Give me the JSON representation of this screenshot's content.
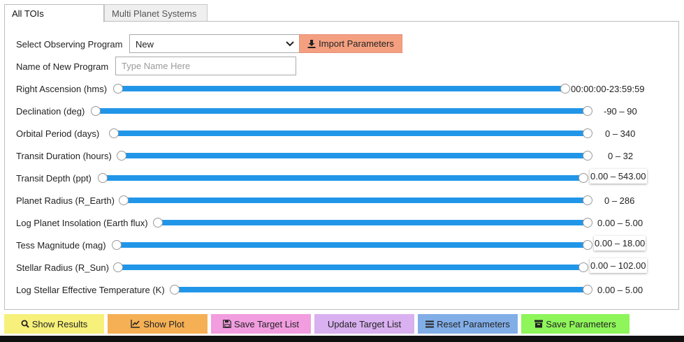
{
  "tabs": [
    {
      "label": "All TOIs",
      "active": true
    },
    {
      "label": "Multi Planet Systems",
      "active": false
    }
  ],
  "program": {
    "select_label": "Select Observing Program",
    "selected": "New",
    "import_label": "Import Parameters",
    "name_label": "Name of New Program",
    "name_value": "",
    "name_placeholder": "Type Name Here"
  },
  "sliders": [
    {
      "label": "Right Ascension (hms)",
      "value": "00:00:00-23:59:59"
    },
    {
      "label": "Declination (deg)",
      "value": "-90 – 90"
    },
    {
      "label": "Orbital Period (days)",
      "value": "0 – 340"
    },
    {
      "label": "Transit Duration (hours)",
      "value": "0 – 32"
    },
    {
      "label": "Transit Depth (ppt)",
      "value": "0.00 – 543.00"
    },
    {
      "label": "Planet Radius (R_Earth)",
      "value": "0 – 286"
    },
    {
      "label": "Log Planet Insolation (Earth flux)",
      "value": "0.00 – 5.00"
    },
    {
      "label": "Tess Magnitude (mag)",
      "value": "0.00 – 18.00"
    },
    {
      "label": "Stellar Radius (R_Sun)",
      "value": "0.00 – 102.00"
    },
    {
      "label": "Log Stellar Effective Temperature (K)",
      "value": "0.00 – 5.00"
    }
  ],
  "buttons": [
    {
      "label": "Show Results",
      "icon": "search-icon",
      "color": "#f7f07a"
    },
    {
      "label": "Show Plot",
      "icon": "line-chart-icon",
      "color": "#f5b055"
    },
    {
      "label": "Save Target List",
      "icon": "floppy-icon",
      "color": "#f29de0"
    },
    {
      "label": "Update Target List",
      "icon": "",
      "color": "#d9b0f0"
    },
    {
      "label": "Reset Parameters",
      "icon": "list-icon",
      "color": "#82aee8"
    },
    {
      "label": "Save Parameters",
      "icon": "archive-icon",
      "color": "#8ef55a"
    }
  ],
  "colors": {
    "slider_track": "#2196e8",
    "import_button": "#f4a080"
  }
}
